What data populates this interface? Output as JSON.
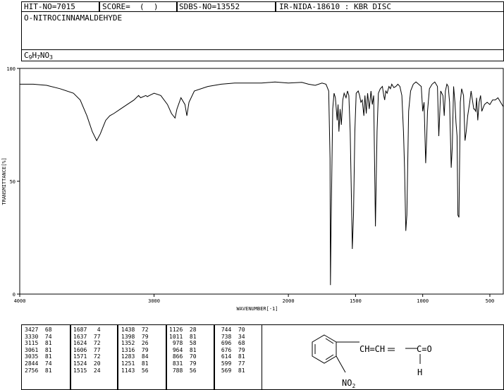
{
  "header": {
    "hit_no": "HIT-NO=7015",
    "score": "SCORE=  (  )",
    "sdbs_no": "SDBS-NO=13552",
    "ir_info": "IR-NIDA-18610 : KBR DISC",
    "compound_name": "O-NITROCINNAMALDEHYDE",
    "formula_parts": [
      {
        "t": "C",
        "sub": false
      },
      {
        "t": "9",
        "sub": true
      },
      {
        "t": "H",
        "sub": false
      },
      {
        "t": "7",
        "sub": true
      },
      {
        "t": "NO",
        "sub": false
      },
      {
        "t": "3",
        "sub": true
      }
    ]
  },
  "chart_data": {
    "type": "line",
    "title": "",
    "xlabel": "WAVENUMBER[-1]",
    "ylabel": "TRANSMITTANCE[%]",
    "xlim": [
      4000,
      400
    ],
    "ylim": [
      0,
      100
    ],
    "x_ticks": [
      4000,
      3000,
      2000,
      1500,
      1000,
      500
    ],
    "x_tick_labels": [
      "4000",
      "3000",
      "2000",
      "1500",
      "1000",
      "500"
    ],
    "y_ticks": [
      0,
      50,
      100
    ],
    "y_tick_labels": [
      "0",
      "50",
      "100"
    ],
    "series": [
      {
        "x": [
          4000,
          3900,
          3800,
          3700,
          3600,
          3550,
          3500,
          3460,
          3427,
          3400,
          3380,
          3360,
          3330,
          3300,
          3250,
          3200,
          3150,
          3115,
          3100,
          3061,
          3050,
          3035,
          3000,
          2950,
          2900,
          2870,
          2844,
          2830,
          2800,
          2770,
          2756,
          2740,
          2700,
          2600,
          2500,
          2400,
          2300,
          2200,
          2100,
          2000,
          1900,
          1850,
          1800,
          1750,
          1720,
          1700,
          1690,
          1687,
          1682,
          1670,
          1660,
          1650,
          1637,
          1630,
          1624,
          1615,
          1606,
          1595,
          1585,
          1571,
          1560,
          1550,
          1540,
          1530,
          1524,
          1515,
          1505,
          1495,
          1480,
          1470,
          1460,
          1450,
          1438,
          1430,
          1420,
          1410,
          1398,
          1385,
          1375,
          1365,
          1352,
          1340,
          1330,
          1316,
          1300,
          1290,
          1283,
          1275,
          1265,
          1251,
          1240,
          1230,
          1215,
          1200,
          1185,
          1170,
          1155,
          1143,
          1135,
          1126,
          1118,
          1105,
          1090,
          1070,
          1050,
          1030,
          1011,
          1000,
          990,
          978,
          970,
          964,
          950,
          930,
          910,
          900,
          890,
          880,
          866,
          850,
          840,
          831,
          820,
          810,
          800,
          788,
          780,
          770,
          760,
          752,
          744,
          738,
          730,
          720,
          710,
          696,
          685,
          676,
          665,
          650,
          640,
          630,
          620,
          614,
          605,
          599,
          590,
          580,
          569,
          560,
          540,
          520,
          500,
          480,
          460,
          440,
          420,
          400
        ],
        "y": [
          93,
          93,
          92.5,
          91,
          89,
          86,
          79,
          72,
          68,
          71,
          74,
          77,
          79,
          80,
          82,
          84,
          86,
          88,
          87,
          88,
          87.5,
          88,
          89,
          88,
          84,
          80,
          78,
          82,
          87,
          84,
          79,
          85,
          90,
          92,
          93,
          93.5,
          93.5,
          93.5,
          94,
          93.5,
          93.8,
          93,
          92.5,
          93.5,
          93,
          90,
          60,
          4,
          30,
          82,
          89,
          87,
          77,
          84,
          72,
          82,
          75,
          86,
          89,
          87,
          90,
          88,
          72,
          40,
          20,
          35,
          72,
          89,
          90,
          88,
          85,
          86,
          79,
          88,
          80,
          89,
          82,
          90,
          84,
          88,
          30,
          72,
          89,
          91,
          92,
          88,
          86,
          90,
          89,
          92,
          91,
          93,
          91.5,
          92,
          93,
          92,
          88,
          72,
          56,
          28,
          35,
          81,
          90,
          93,
          94,
          93,
          92,
          81,
          85,
          58,
          70,
          81,
          91,
          93,
          94,
          93,
          92,
          70,
          90,
          88,
          79,
          90,
          93,
          92,
          85,
          56,
          65,
          92,
          85,
          76,
          70,
          35,
          34,
          85,
          91,
          88,
          68,
          72,
          79,
          85,
          90,
          86,
          82,
          82,
          81,
          87,
          77,
          85,
          88,
          81,
          84,
          85,
          84,
          86,
          86,
          87,
          85,
          83
        ]
      }
    ],
    "peak_table": [
      [
        "3427",
        "68"
      ],
      [
        "3330",
        "74"
      ],
      [
        "3115",
        "81"
      ],
      [
        "3061",
        "81"
      ],
      [
        "3035",
        "81"
      ],
      [
        "2844",
        "74"
      ],
      [
        "2756",
        "81"
      ],
      [
        "1687",
        "4"
      ],
      [
        "1637",
        "77"
      ],
      [
        "1624",
        "72"
      ],
      [
        "1606",
        "77"
      ],
      [
        "1571",
        "72"
      ],
      [
        "1524",
        "20"
      ],
      [
        "1515",
        "24"
      ],
      [
        "1438",
        "72"
      ],
      [
        "1398",
        "79"
      ],
      [
        "1352",
        "26"
      ],
      [
        "1316",
        "79"
      ],
      [
        "1283",
        "84"
      ],
      [
        "1251",
        "81"
      ],
      [
        "1143",
        "56"
      ],
      [
        "1126",
        "28"
      ],
      [
        "1011",
        "81"
      ],
      [
        "978",
        "58"
      ],
      [
        "964",
        "81"
      ],
      [
        "866",
        "70"
      ],
      [
        "831",
        "79"
      ],
      [
        "788",
        "56"
      ],
      [
        "744",
        "70"
      ],
      [
        "738",
        "34"
      ],
      [
        "696",
        "68"
      ],
      [
        "676",
        "79"
      ],
      [
        "614",
        "81"
      ],
      [
        "599",
        "77"
      ],
      [
        "569",
        "81"
      ]
    ]
  },
  "structure": {
    "group1": "CH=CH",
    "group2": "C=O",
    "hydrogen": "H",
    "substituent_base": "NO",
    "substituent_sub": "2"
  }
}
